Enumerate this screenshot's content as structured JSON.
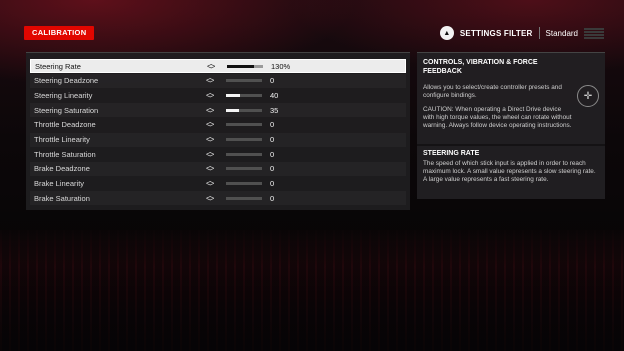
{
  "header": {
    "page_tag": "CALIBRATION",
    "filter_button_glyph": "▲",
    "filter_label": "SETTINGS FILTER",
    "filter_value": "Standard"
  },
  "settings": [
    {
      "name": "Steering Rate",
      "value": "130%",
      "fill": 0.75,
      "selected": true
    },
    {
      "name": "Steering Deadzone",
      "value": "0",
      "fill": 0.0
    },
    {
      "name": "Steering Linearity",
      "value": "40",
      "fill": 0.4
    },
    {
      "name": "Steering Saturation",
      "value": "35",
      "fill": 0.35
    },
    {
      "name": "Throttle Deadzone",
      "value": "0",
      "fill": 0.0
    },
    {
      "name": "Throttle Linearity",
      "value": "0",
      "fill": 0.0
    },
    {
      "name": "Throttle Saturation",
      "value": "0",
      "fill": 0.0
    },
    {
      "name": "Brake Deadzone",
      "value": "0",
      "fill": 0.0
    },
    {
      "name": "Brake Linearity",
      "value": "0",
      "fill": 0.0
    },
    {
      "name": "Brake Saturation",
      "value": "0",
      "fill": 0.0
    }
  ],
  "arrows_glyph": "<>",
  "info": {
    "title": "CONTROLS, VIBRATION & FORCE FEEDBACK",
    "body1": "Allows you to select/create controller presets and configure bindings.",
    "body2": "CAUTION: When operating a Direct Drive device with high torque values, the wheel can rotate without warning. Always follow device operating instructions.",
    "dpad_icon": "dpad-icon",
    "dpad_glyph": "✛",
    "sub_title": "STEERING RATE",
    "sub_body": "The speed of which stick input is applied in order to reach maximum lock. A small value represents a slow steering rate. A large value represents a fast steering rate."
  }
}
